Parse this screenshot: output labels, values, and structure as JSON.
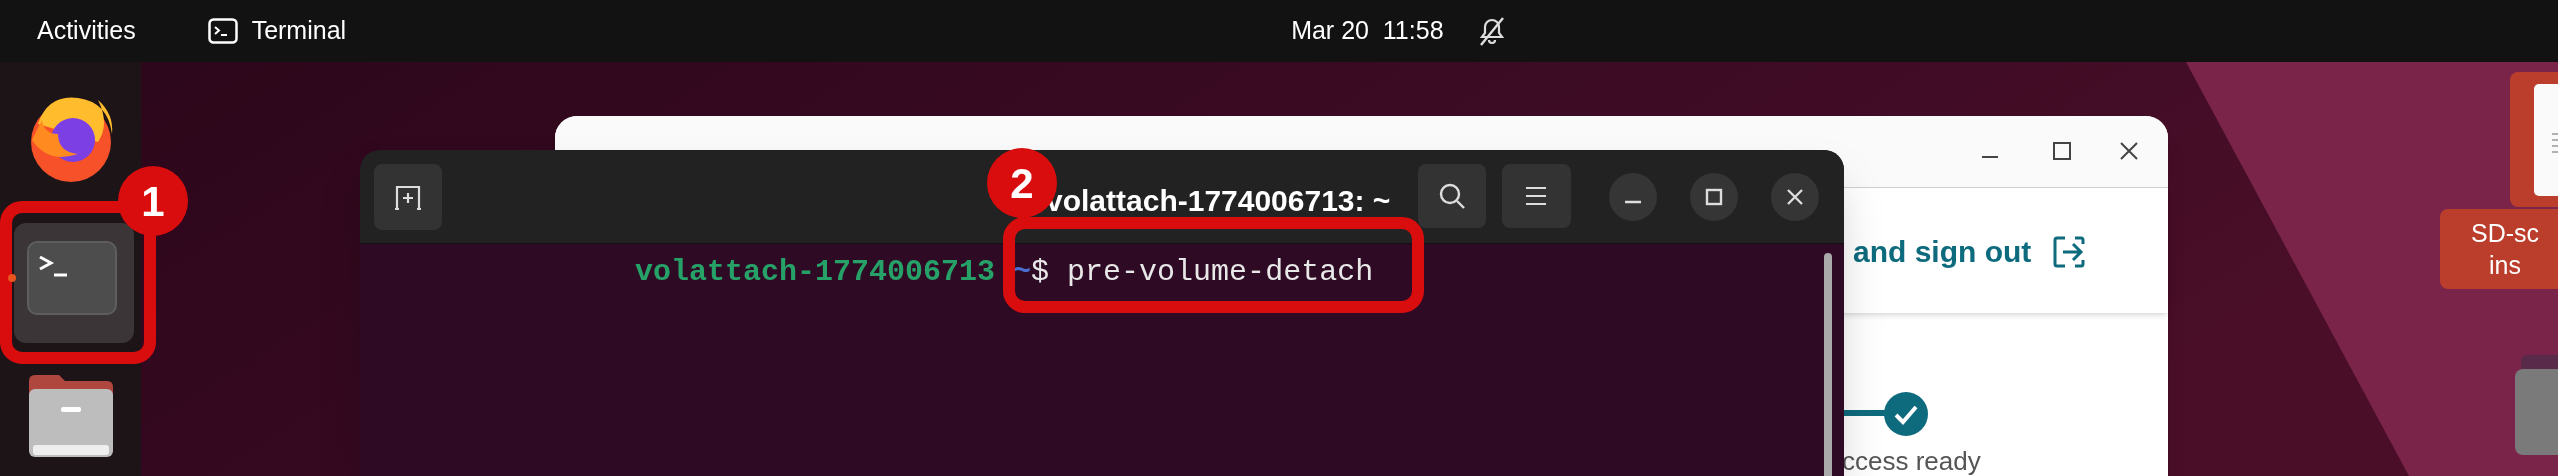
{
  "top_bar": {
    "activities": "Activities",
    "app_name": "Terminal",
    "clock": "Mar 20  11:58",
    "notifications_muted": true
  },
  "dock": {
    "items": [
      {
        "kind": "firefox",
        "running": false
      },
      {
        "kind": "terminal",
        "running": true
      },
      {
        "kind": "files",
        "running": false
      }
    ]
  },
  "browser_window": {
    "header_action": "and sign out",
    "step_label": "ccess ready",
    "step_done": true
  },
  "terminal": {
    "title": "volattach-1774006713: ~",
    "prompt_host": "volattach-1774006713",
    "prompt_path": "~",
    "prompt_symbol": "$",
    "command": "pre-volume-detach"
  },
  "desktop_icons": [
    {
      "kind": "document",
      "label_lines": [
        "SD-sc",
        "ins"
      ]
    },
    {
      "kind": "drive"
    }
  ],
  "annotations": [
    {
      "number": "1"
    },
    {
      "number": "2"
    }
  ]
}
